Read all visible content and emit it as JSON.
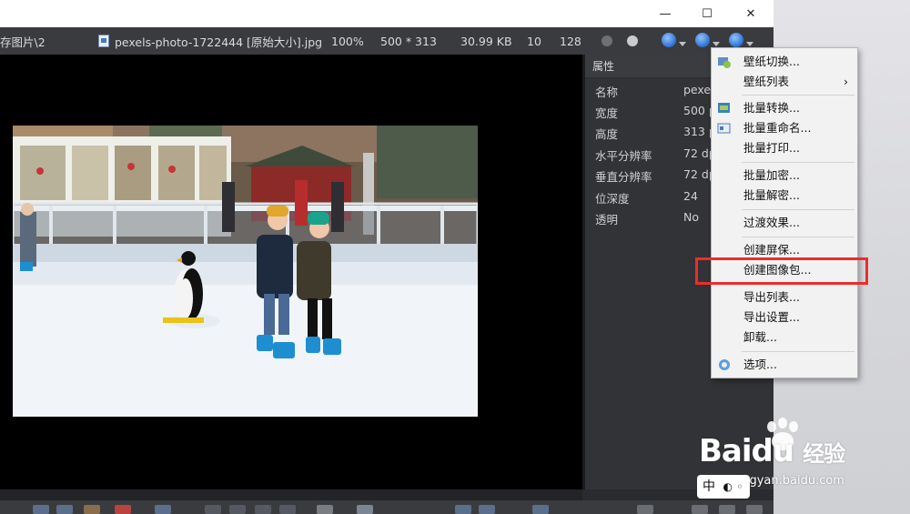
{
  "window": {
    "minimize_glyph": "—",
    "maximize_glyph": "☐",
    "close_glyph": "✕"
  },
  "infobar": {
    "path": "存图片\\2",
    "filename": "pexels-photo-1722444 [原始大小].jpg",
    "zoom": "100%",
    "dimensions": "500 * 313",
    "filesize": "30.99 KB",
    "value_a": "10",
    "value_b": "128"
  },
  "properties": {
    "header": "属性",
    "rows": [
      {
        "key": "名称",
        "value": "pexels"
      },
      {
        "key": "宽度",
        "value": "500 p"
      },
      {
        "key": "高度",
        "value": "313 p"
      },
      {
        "key": "水平分辨率",
        "value": "72 dp"
      },
      {
        "key": "垂直分辨率",
        "value": "72 dp"
      },
      {
        "key": "位深度",
        "value": "24"
      },
      {
        "key": "透明",
        "value": "No"
      }
    ]
  },
  "menu": {
    "items": [
      {
        "label": "壁纸切换...",
        "icon": "wallpaper-icon"
      },
      {
        "label": "壁纸列表",
        "submenu_arrow": "›"
      },
      {
        "label": "批量转换...",
        "icon": "batch-convert-icon"
      },
      {
        "label": "批量重命名...",
        "icon": "batch-rename-icon"
      },
      {
        "label": "批量打印..."
      },
      {
        "label": "批量加密..."
      },
      {
        "label": "批量解密..."
      },
      {
        "label": "过渡效果..."
      },
      {
        "label": "创建屏保..."
      },
      {
        "label": "创建图像包..."
      },
      {
        "label": "导出列表..."
      },
      {
        "label": "导出设置..."
      },
      {
        "label": "卸载..."
      },
      {
        "label": "选项...",
        "icon": "options-icon"
      }
    ]
  },
  "watermark": {
    "brand": "Baidu",
    "brand_cn": "经验",
    "url": "jingyan.baidu.com"
  },
  "ime": {
    "label": "中"
  },
  "colors": {
    "highlight": "#ef2b2b",
    "viewer_bg": "#000000",
    "panel_bg": "#323336"
  }
}
